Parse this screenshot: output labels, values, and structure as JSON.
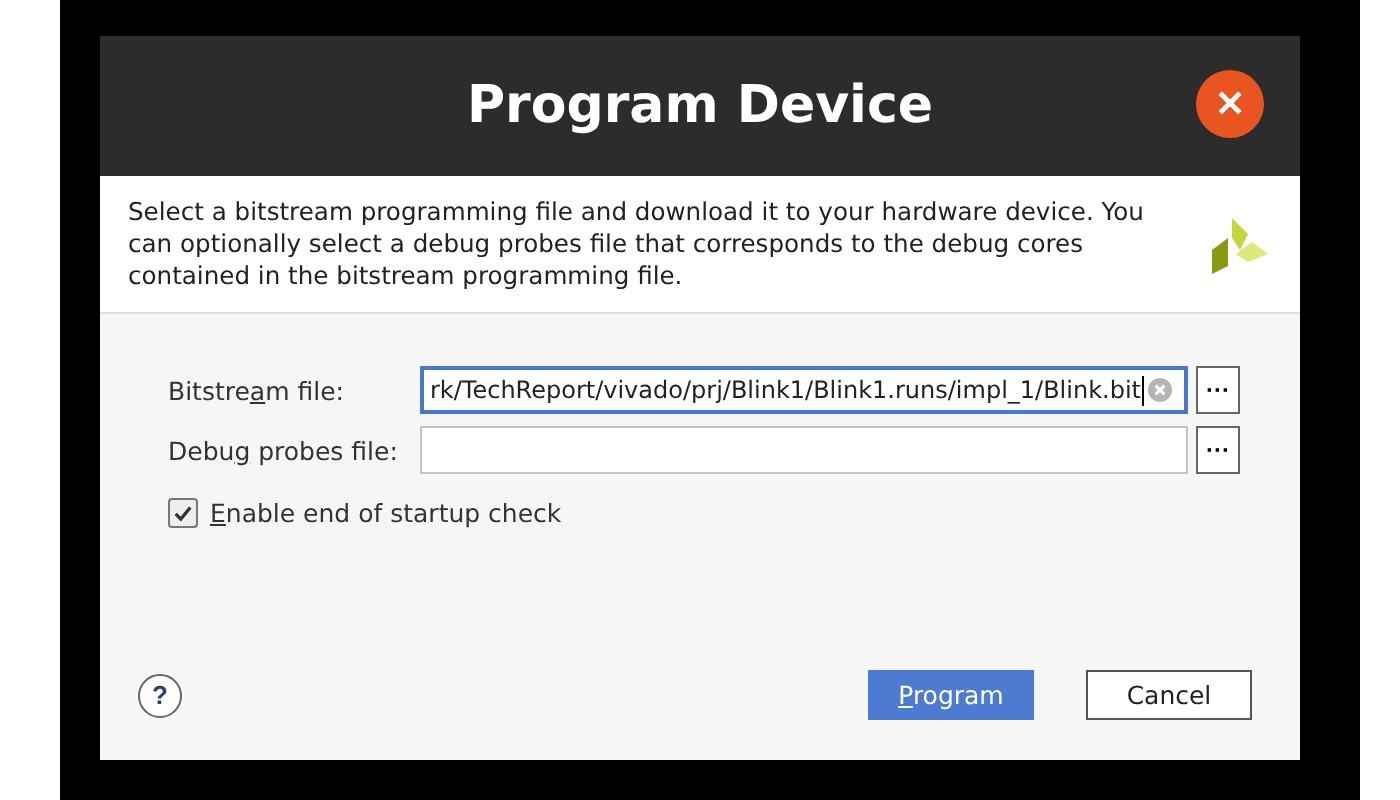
{
  "window": {
    "title": "Program Device",
    "close": "✕"
  },
  "description": "Select a bitstream programming file and download it to your hardware device. You can optionally select a debug probes file that corresponds to the debug cores contained in the bitstream programming file.",
  "fields": [
    {
      "label": {
        "before": "Bitstre",
        "key": "a",
        "after": "m file:"
      },
      "value": "rk/TechReport/vivado/prj/Blink1/Blink1.runs/impl_1/Blink.bit",
      "focused": true,
      "browse": "···"
    },
    {
      "label": {
        "before": "Debu",
        "key": "g",
        "after": " probes file:"
      },
      "focused": false,
      "browse": "···"
    }
  ],
  "checkbox": {
    "label": {
      "key": "E",
      "after": "nable end of startup check"
    },
    "checked": true
  },
  "help": "?",
  "buttons": [
    {
      "label": {
        "key": "P",
        "after": "rogram"
      },
      "kind": "primary"
    },
    {
      "label": {
        "before": "Cancel"
      },
      "kind": "secondary"
    }
  ]
}
